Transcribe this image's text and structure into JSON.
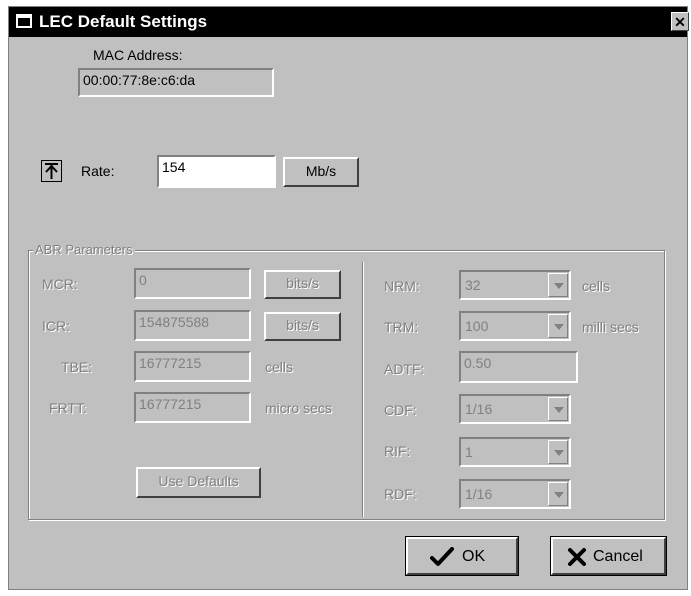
{
  "window": {
    "title": "LEC Default Settings",
    "close": "✕"
  },
  "mac": {
    "label": "MAC Address:",
    "value": "00:00:77:8e:c6:da"
  },
  "rate": {
    "label": "Rate:",
    "value": "154",
    "unit_button": "Mb/s"
  },
  "abr": {
    "group_label": "ABR Parameters",
    "mcr": {
      "label": "MCR:",
      "value": "0",
      "unit": "bits/s"
    },
    "icr": {
      "label": "ICR:",
      "value": "154875588",
      "unit": "bits/s"
    },
    "tbe": {
      "label": "TBE:",
      "value": "16777215",
      "unit": "cells"
    },
    "frtt": {
      "label": "FRTT:",
      "value": "16777215",
      "unit": "micro secs"
    },
    "use_defaults": "Use Defaults",
    "nrm": {
      "label": "NRM:",
      "value": "32",
      "unit": "cells"
    },
    "trm": {
      "label": "TRM:",
      "value": "100",
      "unit": "milli secs"
    },
    "adtf": {
      "label": "ADTF:",
      "value": "0.50"
    },
    "cdf": {
      "label": "CDF:",
      "value": "1/16"
    },
    "rif": {
      "label": "RIF:",
      "value": "1"
    },
    "rdf": {
      "label": "RDF:",
      "value": "1/16"
    }
  },
  "buttons": {
    "ok": "OK",
    "cancel": "Cancel"
  },
  "icons": {
    "ok": "checkmark-icon",
    "cancel": "x-icon",
    "rate_toggle": "arrow-up-bar-icon",
    "window": "window-icon"
  }
}
